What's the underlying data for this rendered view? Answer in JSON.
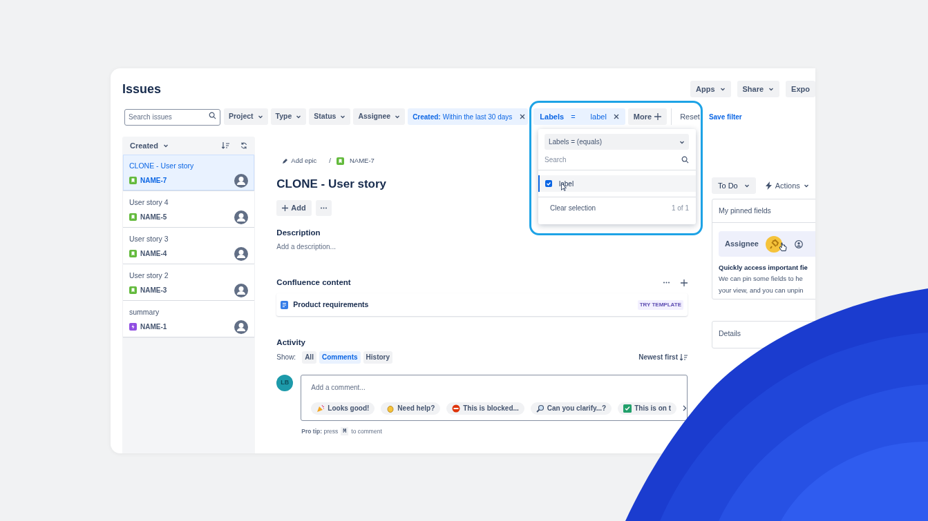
{
  "page_title": "Issues",
  "header_buttons": [
    "Apps",
    "Share",
    "Expo"
  ],
  "search": {
    "placeholder": "Search issues"
  },
  "filters": [
    "Project",
    "Type",
    "Status",
    "Assignee"
  ],
  "created_filter": {
    "label": "Created:",
    "value": "Within the last 30 days"
  },
  "labels_filter": {
    "label": "Labels",
    "operator": "=",
    "value": "label"
  },
  "more": "More",
  "reset": "Reset",
  "save_filter": "Save filter",
  "labels_dropdown": {
    "operator": "Labels = (equals)",
    "search_placeholder": "Search",
    "options": [
      {
        "label": "label",
        "checked": true
      }
    ],
    "clear": "Clear selection",
    "count": "1 of 1"
  },
  "list": {
    "sort": "Created",
    "items": [
      {
        "title": "CLONE - User story",
        "key": "NAME-7",
        "kind": "story",
        "selected": true
      },
      {
        "title": "User story 4",
        "key": "NAME-5",
        "kind": "story",
        "selected": false
      },
      {
        "title": "User story 3",
        "key": "NAME-4",
        "kind": "story",
        "selected": false
      },
      {
        "title": "User story 2",
        "key": "NAME-3",
        "kind": "story",
        "selected": false
      },
      {
        "title": "summary",
        "key": "NAME-1",
        "kind": "epic",
        "selected": false
      }
    ]
  },
  "issue": {
    "epic": "Add epic",
    "separator": "/",
    "key": "NAME-7",
    "title": "CLONE - User story",
    "add": "Add",
    "description_heading": "Description",
    "description_placeholder": "Add a description...",
    "confluence_heading": "Confluence content",
    "confluence_items": [
      {
        "title": "Product requirements",
        "badge": "TRY TEMPLATE"
      }
    ],
    "activity_heading": "Activity",
    "show_label": "Show:",
    "activity_tabs": [
      {
        "label": "All",
        "selected": false
      },
      {
        "label": "Comments",
        "selected": true
      },
      {
        "label": "History",
        "selected": false
      }
    ],
    "sort": "Newest first",
    "avatar": "LB",
    "comment_placeholder": "Add a comment...",
    "quick_replies": [
      {
        "label": "Looks good!",
        "kind": "party"
      },
      {
        "label": "Need help?",
        "kind": "clap"
      },
      {
        "label": "This is blocked...",
        "kind": "stop"
      },
      {
        "label": "Can you clarify...?",
        "kind": "magnifier"
      },
      {
        "label": "This is on t",
        "kind": "check"
      }
    ],
    "pro_tip": "**Pro tip:** press",
    "pro_tip_key": "M",
    "pro_tip_end": "to comment"
  },
  "side": {
    "status": "To Do",
    "actions": "Actions",
    "pinned_heading": "My pinned fields",
    "pinned_field": "Assignee",
    "tip_title": "Quickly access important fie",
    "tip_lines": [
      "We can pin some fields to he",
      "your view, and you can unpin"
    ],
    "details_heading": "Details"
  }
}
